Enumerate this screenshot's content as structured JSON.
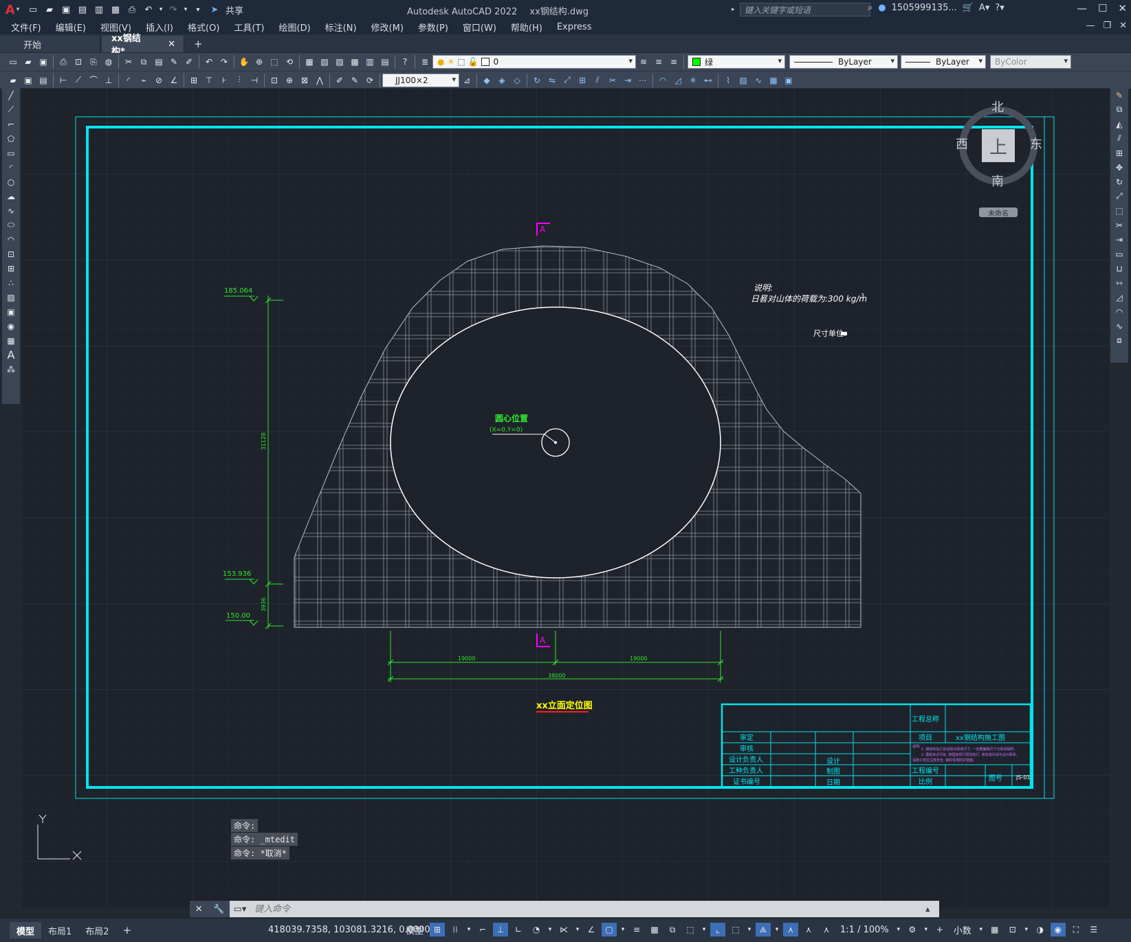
{
  "title_bar": {
    "app_name": "Autodesk AutoCAD 2022",
    "file_name": "xx钢结构.dwg",
    "share_label": "共享",
    "search_placeholder": "键入关键字或短语",
    "user_name": "1505999135..."
  },
  "menu": [
    "文件(F)",
    "编辑(E)",
    "视图(V)",
    "插入(I)",
    "格式(O)",
    "工具(T)",
    "绘图(D)",
    "标注(N)",
    "修改(M)",
    "参数(P)",
    "窗口(W)",
    "帮助(H)",
    "Express"
  ],
  "tabs": [
    {
      "label": "开始",
      "active": false
    },
    {
      "label": "xx钢结构*",
      "active": true
    }
  ],
  "toolbar": {
    "layer_value": "0",
    "color_value": "绿",
    "color_hex": "#00ff00",
    "linetype_value": "ByLayer",
    "lineweight_value": "ByLayer",
    "plotstyle_value": "ByColor",
    "dimstyle_value": "JJ100×2"
  },
  "viewcube": {
    "north": "北",
    "south": "南",
    "east": "东",
    "west": "西",
    "top": "上",
    "ucs": "未命名"
  },
  "drawing": {
    "note_title": "说明:",
    "note_text": "日晷对山体的荷载为:300 kg/m",
    "note_superscript": "3",
    "unit_label": "尺寸单位:",
    "section_label_top": "A",
    "section_label_bottom": "A",
    "center_label": "圆心位置",
    "center_coords": "(X=0,Y=0)",
    "elev_1": "185.064",
    "elev_2": "153.936",
    "elev_3": "150.00",
    "dim_vert_1": "31128",
    "dim_vert_2": "3936",
    "dim_h_left": "19000",
    "dim_h_right": "19000",
    "dim_h_total": "38000",
    "drawing_title": "xx立面定位图"
  },
  "title_block": {
    "project_name_label": "工程总称",
    "project_label": "项目",
    "project_value": "xx钢结构施工图",
    "rows_left": [
      "审定",
      "审核",
      "设计负责人",
      "工种负责人",
      "证书编号"
    ],
    "rows_mid": [
      "设计",
      "制图",
      "日期"
    ],
    "notes_heading": "说明:",
    "notes_line_1": "1. 钢结构加工前请核对现场尺寸, 一定要确保尺寸与现场相符。",
    "notes_line_2": "2. 图纸未详尽处, 按国家现行规范执行, 若有疑问请与设计联系。",
    "notes_line_3": "请施工单位注意安全, 做好现场防护措施。",
    "project_number_label": "工程编号",
    "drawing_number_label": "图号",
    "scale_label": "比例",
    "drawing_number_value": "JS-01"
  },
  "command_line": {
    "history": [
      "命令:",
      "命令: _mtedit",
      "命令: *取消*"
    ],
    "placeholder": "键入命令"
  },
  "status_bar": {
    "layout_tabs": [
      {
        "label": "模型",
        "active": true
      },
      {
        "label": "布局1",
        "active": false
      },
      {
        "label": "布局2",
        "active": false
      }
    ],
    "coordinates": "418039.7358, 103081.3216, 0.0000",
    "space_label": "模型",
    "scale_label": "1:1 / 100%",
    "units_label": "小数"
  },
  "colors": {
    "cyan_frame": "#00e5ee",
    "green_dims": "#2fe82f",
    "magenta_section": "#ff00ff",
    "yellow_title": "#ffff00",
    "grid_major": "#2a3140",
    "grid_minor": "#232831"
  }
}
